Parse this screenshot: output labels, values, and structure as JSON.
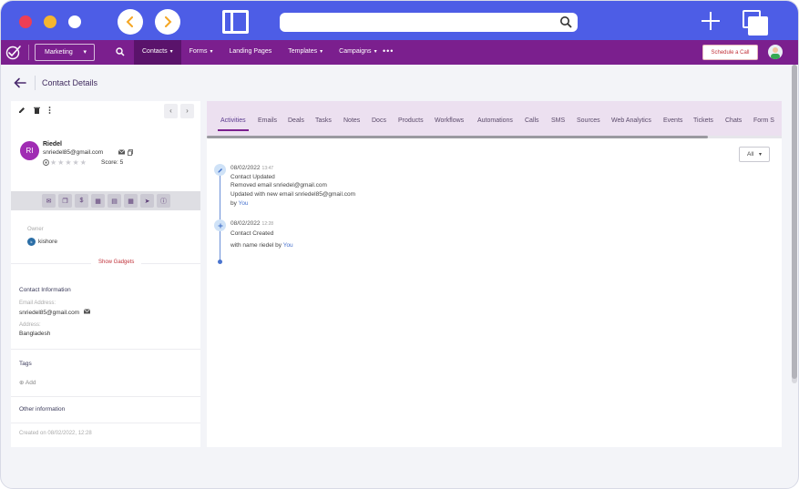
{
  "browser": {
    "url": ""
  },
  "app": {
    "workspace": "Marketing",
    "nav": [
      {
        "label": "Contacts",
        "dropdown": true,
        "active": true
      },
      {
        "label": "Forms",
        "dropdown": true
      },
      {
        "label": "Landing Pages",
        "dropdown": false
      },
      {
        "label": "Templates",
        "dropdown": true
      },
      {
        "label": "Campaigns",
        "dropdown": true
      }
    ],
    "more": "•••",
    "schedule_button": "Schedule a Call",
    "accent": "#7b1f8e"
  },
  "page": {
    "title": "Contact Details"
  },
  "contact": {
    "initials": "RI",
    "name": "Riedel",
    "email": "snriedel85@gmail.com",
    "score_label": "Score: 5",
    "rating": 0,
    "owner_label": "Owner",
    "owner_initials": "k",
    "owner_name": "kishore",
    "show_gadgets": "Show Gadgets",
    "contact_info_title": "Contact Information",
    "email_label": "Email Address:",
    "email_value": "snriedel85@gmail.com",
    "address_label": "Address:",
    "address_value": "Bangladesh",
    "tags_title": "Tags",
    "add_label": "⊕ Add",
    "other_title": "Other information",
    "created_on": "Created on 08/02/2022, 12:28"
  },
  "tabs": [
    "Activities",
    "Emails",
    "Deals",
    "Tasks",
    "Notes",
    "Docs",
    "Products",
    "Workflows",
    "Automations",
    "Calls",
    "SMS",
    "Sources",
    "Web Analytics",
    "Events",
    "Tickets",
    "Chats",
    "Form S"
  ],
  "filter": {
    "label": "All"
  },
  "timeline": [
    {
      "date": "08/02/2022",
      "time": "13:47",
      "icon": "pencil-icon",
      "title": "Contact Updated",
      "line1": "Removed email snriedel@gmail.com",
      "line2": "Updated with new email snriedel85@gmail.com",
      "by_prefix": "by",
      "by": "You"
    },
    {
      "date": "08/02/2022",
      "time": "12:28",
      "icon": "plus-icon",
      "title": "Contact Created",
      "line1_prefix": "with name riedel by",
      "by": "You"
    }
  ]
}
